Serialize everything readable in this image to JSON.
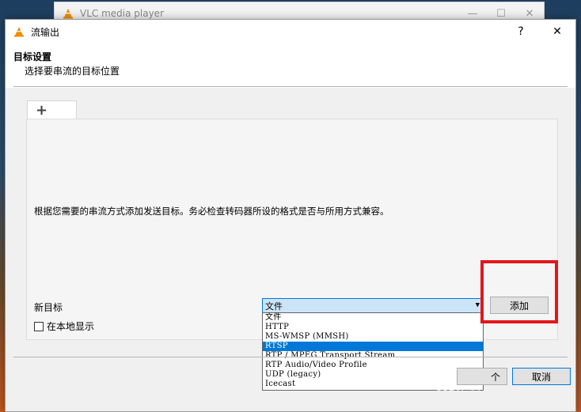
{
  "background_window": {
    "title": "VLC media player",
    "minimize": "—",
    "maximize": "☐",
    "close": "✕",
    "volume_label": "◀)"
  },
  "dialog": {
    "title": "流输出",
    "help_button": "?",
    "close_button": "✕",
    "heading": "目标设置",
    "subheading": "选择要串流的目标位置",
    "tab_add_icon": "+",
    "info_text": "根据您需要的串流方式添加发送目标。务必检查转码器所设的格式是否与所用方式兼容。",
    "new_target_label": "新目标",
    "local_display_label": "在本地显示",
    "selected_target": "文件",
    "target_options": [
      "文件",
      "HTTP",
      "MS-WMSP (MMSH)",
      "RTSP",
      "RTP / MPEG Transport Stream",
      "RTP Audio/Video Profile",
      "UDP (legacy)",
      "Icecast"
    ],
    "highlighted_option": "RTSP",
    "add_button": "添加",
    "next_button": "个",
    "cancel_button": "取消"
  },
  "watermark": "CSDN @huangleilsme",
  "colors": {
    "accent": "#0078d7",
    "highlight_box": "#e4161c",
    "dialog_bg": "#f0f0f0"
  }
}
